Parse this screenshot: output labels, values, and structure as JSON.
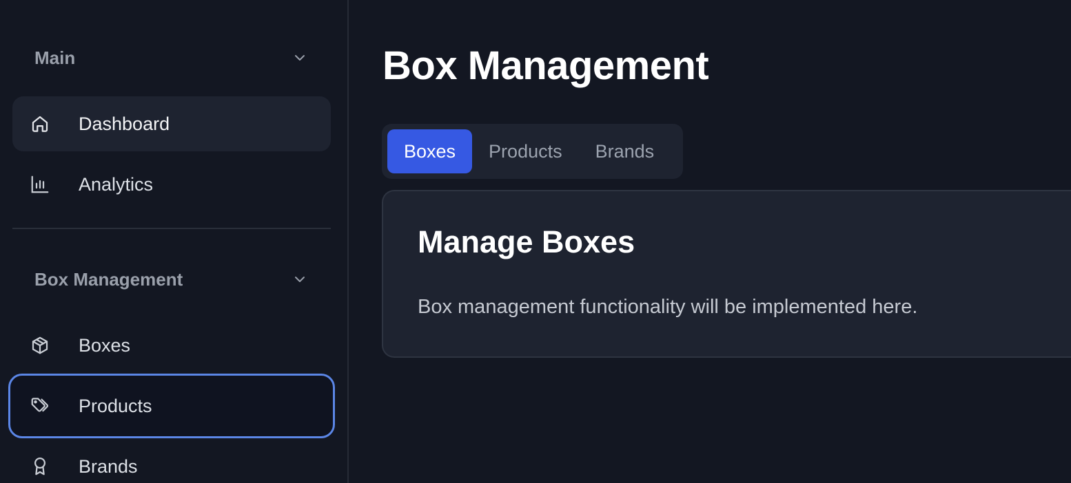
{
  "sidebar": {
    "sections": [
      {
        "title": "Main",
        "items": [
          {
            "label": "Dashboard",
            "icon": "home-icon"
          },
          {
            "label": "Analytics",
            "icon": "bar-chart-icon"
          }
        ]
      },
      {
        "title": "Box Management",
        "items": [
          {
            "label": "Boxes",
            "icon": "box-icon"
          },
          {
            "label": "Products",
            "icon": "tags-icon"
          },
          {
            "label": "Brands",
            "icon": "award-icon"
          }
        ]
      }
    ]
  },
  "main": {
    "page_title": "Box Management",
    "tabs": [
      {
        "label": "Boxes",
        "selected": true
      },
      {
        "label": "Products",
        "selected": false
      },
      {
        "label": "Brands",
        "selected": false
      }
    ],
    "card": {
      "title": "Manage Boxes",
      "text": "Box management functionality will be implemented here."
    }
  },
  "colors": {
    "background": "#131722",
    "panel": "#1e2330",
    "accent": "#3659e3",
    "focus_ring": "#5b86e6"
  }
}
